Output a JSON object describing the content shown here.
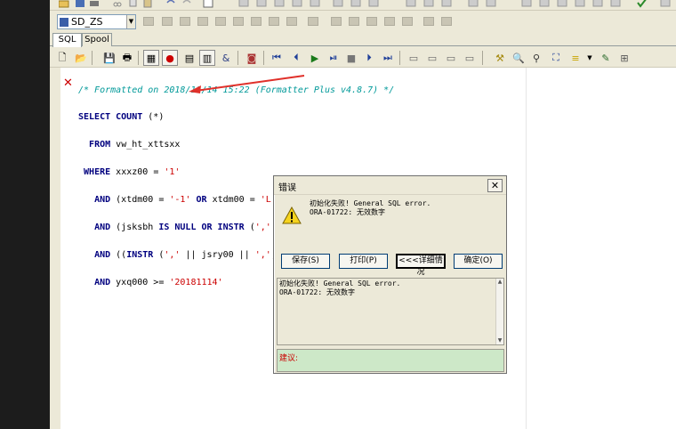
{
  "toolbar": {
    "schema_combo_value": "SD_ZS"
  },
  "tabs": [
    {
      "label": "SQL",
      "active": true
    },
    {
      "label": "Spool",
      "active": false
    }
  ],
  "editor": {
    "comment_line": "/* Formatted on 2018/11/14 15:22 (Formatter Plus v4.8.7) */",
    "lines": [
      "SELECT COUNT (*)",
      "  FROM vw_ht_xttsxx",
      " WHERE xxxz00 = '1'",
      "   AND (xtdm00 = '-1' OR xtdm00 = 'L')",
      "   AND (jsksbh IS NULL OR INSTR (',' || jsksbh || ',', ',215,') > 0)",
      "   AND ((INSTR (',' || jsry00 || ',', ',955,') > 0) OR NVL (jsry00, 0) = 0)",
      "   AND yxq000 >= '20181114'"
    ]
  },
  "dialog": {
    "title": "错误",
    "message_line1": "初始化失败! General SQL error.",
    "message_line2": "ORA-01722: 无效数字",
    "buttons": {
      "save": "保存(S)",
      "print": "打印(P)",
      "details": "<<<详细情况",
      "ok": "确定(O)"
    },
    "detail_line1": "初始化失败! General SQL error.",
    "detail_line2": "ORA-01722: 无效数字",
    "suggestion_label": "建议:"
  },
  "colors": {
    "keyword": "#00007f",
    "comment": "#009999",
    "string": "#cc0000",
    "error_marker": "#cc0000",
    "suggestion_bg": "#cde8c8",
    "annotation_arrow": "#e0302a"
  }
}
